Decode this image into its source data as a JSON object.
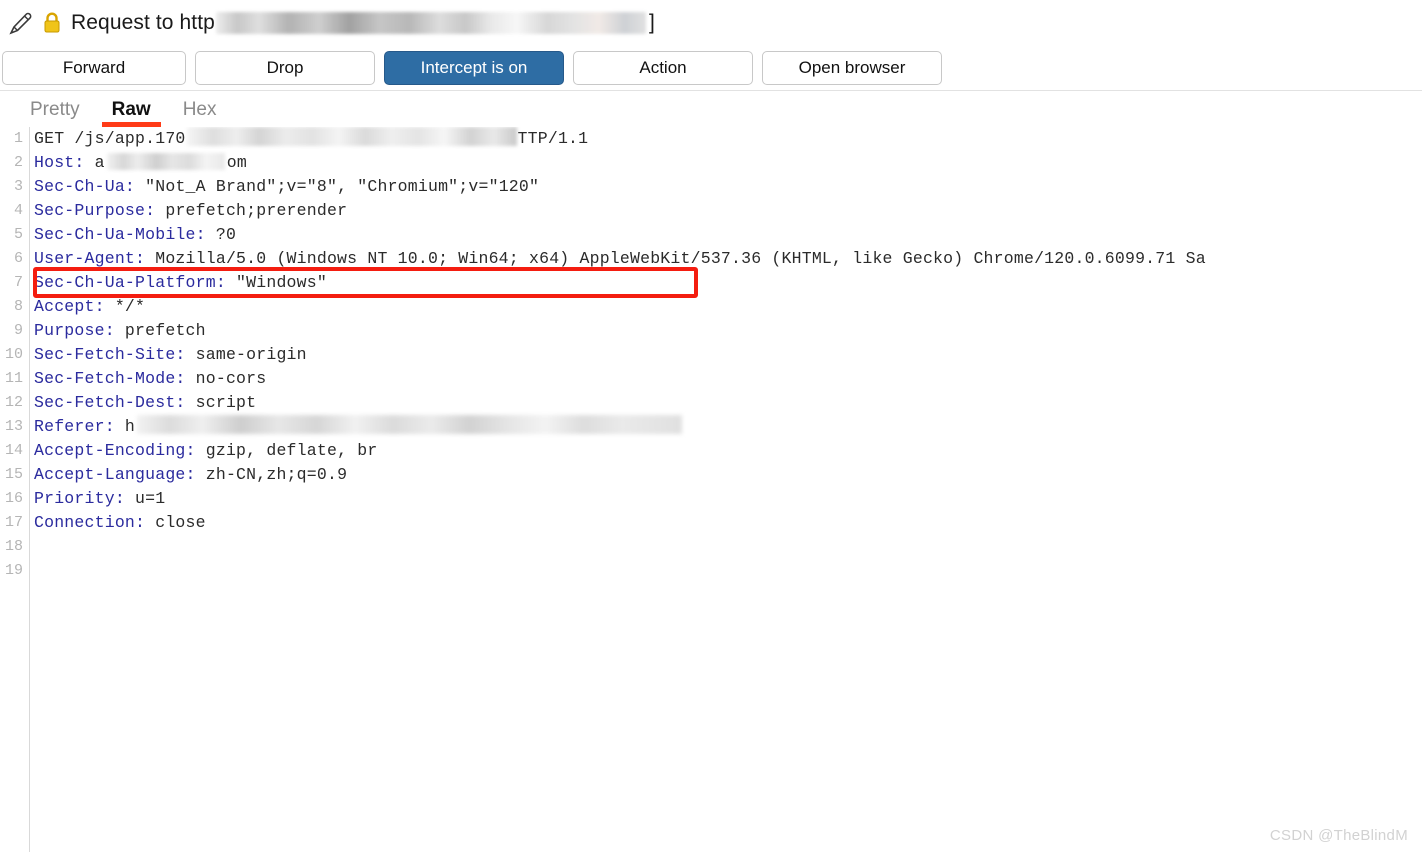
{
  "titlebar": {
    "pencil_icon": "pencil-icon",
    "lock_icon": "lock-icon",
    "prefix": "Request to http",
    "redacted_host": "",
    "suffix": "]"
  },
  "toolbar": {
    "forward": "Forward",
    "drop": "Drop",
    "intercept": "Intercept is on",
    "action": "Action",
    "open_browser": "Open browser",
    "accent_color": "#2e6da4"
  },
  "tabs": [
    {
      "label": "Pretty",
      "active": false
    },
    {
      "label": "Raw",
      "active": true
    },
    {
      "label": "Hex",
      "active": false
    }
  ],
  "tab_underline_color": "#ff3b17",
  "highlight_box_color": "#f41d10",
  "editor": {
    "line_numbers": [
      1,
      2,
      3,
      4,
      5,
      6,
      7,
      8,
      9,
      10,
      11,
      12,
      13,
      14,
      15,
      16,
      17,
      18,
      19
    ],
    "lines": [
      {
        "n": 1,
        "type": "request",
        "text": "GET /js/app.170",
        "redacted": true,
        "tail": "TTP/1.1"
      },
      {
        "n": 2,
        "type": "header",
        "name": "Host:",
        "value": "a",
        "redacted": true,
        "tail": "om"
      },
      {
        "n": 3,
        "type": "header",
        "name": "Sec-Ch-Ua:",
        "value": "\"Not_A Brand\";v=\"8\", \"Chromium\";v=\"120\""
      },
      {
        "n": 4,
        "type": "header",
        "name": "Sec-Purpose:",
        "value": "prefetch;prerender"
      },
      {
        "n": 5,
        "type": "header",
        "name": "Sec-Ch-Ua-Mobile:",
        "value": "?0"
      },
      {
        "n": 6,
        "type": "header",
        "name": "User-Agent:",
        "value": "Mozilla/5.0 (Windows NT 10.0; Win64; x64) AppleWebKit/537.36 (KHTML, like Gecko) Chrome/120.0.6099.71 Sa"
      },
      {
        "n": 7,
        "type": "header",
        "name": "Sec-Ch-Ua-Platform:",
        "value": "\"Windows\""
      },
      {
        "n": 8,
        "type": "header",
        "name": "Accept:",
        "value": "*/*"
      },
      {
        "n": 9,
        "type": "header",
        "name": "Purpose:",
        "value": "prefetch"
      },
      {
        "n": 10,
        "type": "header",
        "name": "Sec-Fetch-Site:",
        "value": "same-origin"
      },
      {
        "n": 11,
        "type": "header",
        "name": "Sec-Fetch-Mode:",
        "value": "no-cors"
      },
      {
        "n": 12,
        "type": "header",
        "name": "Sec-Fetch-Dest:",
        "value": "script"
      },
      {
        "n": 13,
        "type": "header",
        "name": "Referer:",
        "value": "h",
        "redacted": true,
        "tail": ""
      },
      {
        "n": 14,
        "type": "header",
        "name": "Accept-Encoding:",
        "value": "gzip, deflate, br"
      },
      {
        "n": 15,
        "type": "header",
        "name": "Accept-Language:",
        "value": "zh-CN,zh;q=0.9"
      },
      {
        "n": 16,
        "type": "header",
        "name": "Priority:",
        "value": "u=1"
      },
      {
        "n": 17,
        "type": "header",
        "name": "Connection:",
        "value": "close"
      },
      {
        "n": 18,
        "type": "blank",
        "name": "",
        "value": ""
      },
      {
        "n": 19,
        "type": "blank",
        "name": "",
        "value": ""
      }
    ]
  },
  "watermark": "CSDN @TheBlindM"
}
